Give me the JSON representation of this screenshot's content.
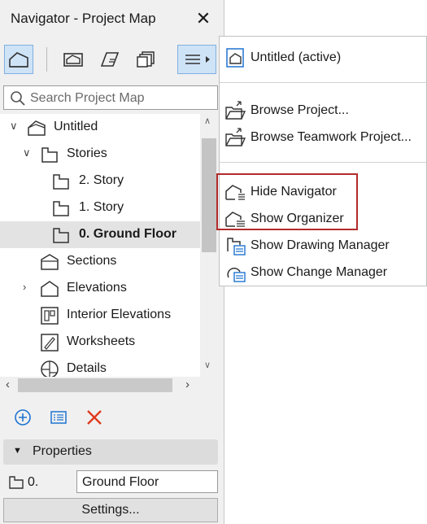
{
  "window": {
    "title": "Navigator - Project Map",
    "close_glyph": "✕"
  },
  "search": {
    "placeholder": "Search Project Map"
  },
  "tree": [
    {
      "label": "Untitled",
      "icon": "project-icon",
      "level": 0,
      "expanded": true
    },
    {
      "label": "Stories",
      "icon": "story-folder-icon",
      "level": 1,
      "expanded": true
    },
    {
      "label": "2. Story",
      "icon": "story-icon",
      "level": 2
    },
    {
      "label": "1. Story",
      "icon": "story-icon",
      "level": 2
    },
    {
      "label": "0. Ground Floor",
      "icon": "story-icon",
      "level": 2,
      "selected": true
    },
    {
      "label": "Sections",
      "icon": "section-icon",
      "level": 1
    },
    {
      "label": "Elevations",
      "icon": "elevation-icon",
      "level": 1,
      "collapsed": true
    },
    {
      "label": "Interior Elevations",
      "icon": "interior-elevation-icon",
      "level": 1
    },
    {
      "label": "Worksheets",
      "icon": "worksheet-icon",
      "level": 1
    },
    {
      "label": "Details",
      "icon": "detail-icon",
      "level": 1
    }
  ],
  "properties": {
    "header": "Properties",
    "number": "0.",
    "name": "Ground Floor",
    "settings_label": "Settings..."
  },
  "menu": {
    "items": [
      {
        "label": "Untitled (active)",
        "icon": "project-file-icon"
      },
      {
        "label": "Browse Project...",
        "icon": "browse-project-icon"
      },
      {
        "label": "Browse Teamwork Project...",
        "icon": "browse-teamwork-icon"
      },
      {
        "label": "Hide Navigator",
        "icon": "hide-navigator-icon"
      },
      {
        "label": "Show Organizer",
        "icon": "show-organizer-icon"
      },
      {
        "label": "Show Drawing Manager",
        "icon": "drawing-manager-icon"
      },
      {
        "label": "Show Change Manager",
        "icon": "change-manager-icon"
      }
    ]
  },
  "colors": {
    "selection": "#e3e3e3",
    "active_button": "#cfe3f7",
    "highlight_box": "#b22b2b",
    "add_icon": "#1e73d1",
    "delete_icon": "#e03a1e"
  }
}
